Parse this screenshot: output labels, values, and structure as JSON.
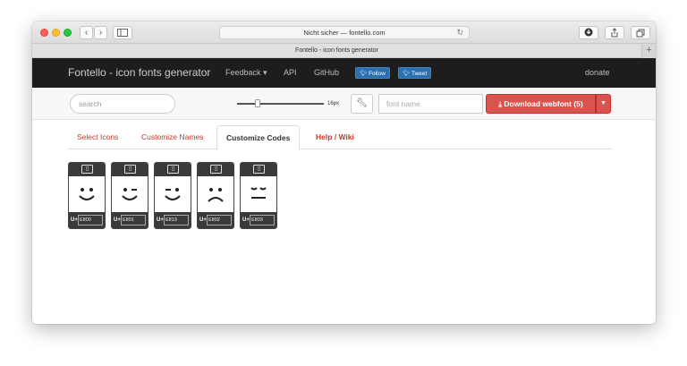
{
  "browser": {
    "address": "Nicht sicher — fontello.com",
    "tab_title": "Fontello - icon fonts generator",
    "reload_glyph": "↻",
    "new_tab_glyph": "+"
  },
  "nav": {
    "brand": "Fontello - icon fonts generator",
    "links": [
      "Feedback ▾",
      "API",
      "GitHub"
    ],
    "follow": "Follow",
    "tweet": "Tweet",
    "donate": "donate"
  },
  "toolbar": {
    "search_placeholder": "search",
    "size_label": "16px",
    "size_value": 16,
    "slider_fraction": 0.25,
    "fontname_placeholder": "font name",
    "download_label": "Download webfont (5)"
  },
  "tabs": [
    {
      "label": "Select Icons"
    },
    {
      "label": "Customize Names"
    },
    {
      "label": "Customize Codes"
    },
    {
      "label": "Help / Wiki"
    }
  ],
  "active_tab": "Customize Codes",
  "glyphs": [
    {
      "icon": "smile-icon",
      "prefix": "U+",
      "code": "E800"
    },
    {
      "icon": "wink-icon",
      "prefix": "U+",
      "code": "E801"
    },
    {
      "icon": "wink-alt-icon",
      "prefix": "U+",
      "code": "E813"
    },
    {
      "icon": "frown-icon",
      "prefix": "U+",
      "code": "E802"
    },
    {
      "icon": "sleep-icon",
      "prefix": "U+",
      "code": "E803"
    }
  ],
  "colors": {
    "accent": "#d9534f",
    "link": "#c0392b",
    "navbar": "#1d1d1d",
    "twitter": "#2a6fb0"
  }
}
